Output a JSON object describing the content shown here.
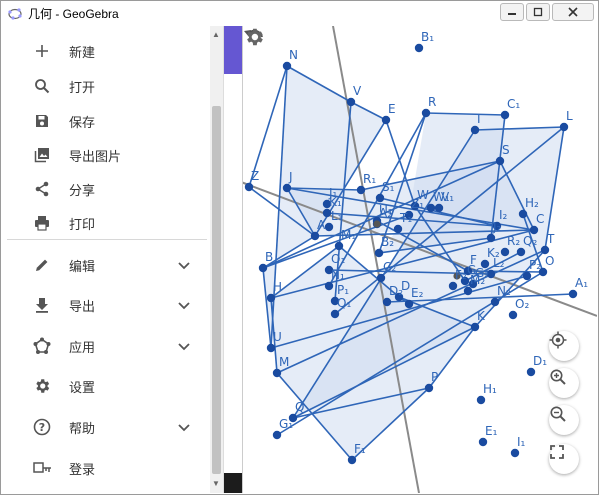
{
  "window": {
    "title": "几何 - GeoGebra"
  },
  "menu": {
    "items": [
      {
        "label": "新建",
        "icon": "plus-icon"
      },
      {
        "label": "打开",
        "icon": "search-icon"
      },
      {
        "label": "保存",
        "icon": "floppy-save-icon"
      },
      {
        "label": "导出图片",
        "icon": "image-export-icon"
      },
      {
        "label": "分享",
        "icon": "share-icon"
      },
      {
        "label": "打印",
        "icon": "printer-icon"
      },
      {
        "label": "编辑",
        "icon": "pencil-icon"
      },
      {
        "label": "导出",
        "icon": "download-icon"
      },
      {
        "label": "应用",
        "icon": "pentagon-apps-icon"
      },
      {
        "label": "设置",
        "icon": "gear-icon"
      },
      {
        "label": "帮助",
        "icon": "help-circle-icon"
      },
      {
        "label": "登录",
        "icon": "sign-in-key-icon"
      }
    ]
  },
  "colors": {
    "accent": "#6557d2",
    "point": "#1a4ba0",
    "segment": "#2f66b8",
    "fill": "#cfdcf1",
    "axis": "#8a8a8a"
  },
  "graphics": {
    "points": [
      {
        "id": "N",
        "label": "N"
      },
      {
        "id": "B1",
        "label": "B₁"
      },
      {
        "id": "V",
        "label": "V"
      },
      {
        "id": "E",
        "label": "E"
      },
      {
        "id": "R",
        "label": "R"
      },
      {
        "id": "C1",
        "label": "C₁"
      },
      {
        "id": "I",
        "label": "I"
      },
      {
        "id": "L",
        "label": "L"
      },
      {
        "id": "S",
        "label": "S"
      },
      {
        "id": "J",
        "label": "J"
      },
      {
        "id": "Z",
        "label": "Z"
      },
      {
        "id": "R1",
        "label": "R₁"
      },
      {
        "id": "S1",
        "label": "S₁"
      },
      {
        "id": "W",
        "label": "W"
      },
      {
        "id": "H2",
        "label": "H₂"
      },
      {
        "id": "C",
        "label": "C"
      },
      {
        "id": "A",
        "label": "A"
      },
      {
        "id": "Q2",
        "label": "Q₂"
      },
      {
        "id": "T",
        "label": "T"
      },
      {
        "id": "B",
        "label": "B"
      },
      {
        "id": "G",
        "label": "G"
      },
      {
        "id": "A1",
        "label": "A₁"
      },
      {
        "id": "H",
        "label": "H"
      },
      {
        "id": "U",
        "label": "U"
      },
      {
        "id": "M",
        "label": "M"
      },
      {
        "id": "Q",
        "label": "Q"
      },
      {
        "id": "G1",
        "label": "G₁"
      },
      {
        "id": "F1",
        "label": "F₁"
      },
      {
        "id": "P",
        "label": "P"
      },
      {
        "id": "H1",
        "label": "H₁"
      },
      {
        "id": "D1",
        "label": "D₁"
      },
      {
        "id": "E1",
        "label": "E₁"
      },
      {
        "id": "I1",
        "label": "I₁"
      },
      {
        "id": "K",
        "label": "K"
      },
      {
        "id": "O2",
        "label": "O₂"
      },
      {
        "id": "N2",
        "label": "N₂"
      },
      {
        "id": "D",
        "label": "D"
      },
      {
        "id": "E2",
        "label": "E₂"
      },
      {
        "id": "P2",
        "label": "P₂"
      },
      {
        "id": "O",
        "label": "O"
      },
      {
        "id": "C2",
        "label": "C₂"
      },
      {
        "id": "B2",
        "label": "B₂"
      },
      {
        "id": "F",
        "label": "F"
      },
      {
        "id": "M2",
        "label": "M₂"
      },
      {
        "id": "K2",
        "label": "K₂"
      },
      {
        "id": "J2",
        "label": "J₂"
      },
      {
        "id": "I2",
        "label": "I₂"
      },
      {
        "id": "R2",
        "label": "R₂"
      },
      {
        "id": "F2",
        "label": "F₂"
      },
      {
        "id": "L2",
        "label": "L₂"
      },
      {
        "id": "G2",
        "label": "G₂"
      },
      {
        "id": "Z1",
        "label": "Z₁"
      },
      {
        "id": "V1",
        "label": "V₁"
      },
      {
        "id": "W1",
        "label": "W₁"
      },
      {
        "id": "U1",
        "label": "U₁"
      },
      {
        "id": "A2",
        "label": "A₂"
      },
      {
        "id": "K1",
        "label": "K₁"
      },
      {
        "id": "J1",
        "label": "J₁"
      },
      {
        "id": "L1",
        "label": "L₁"
      },
      {
        "id": "M1",
        "label": "M₁"
      },
      {
        "id": "O1",
        "label": "O₁"
      },
      {
        "id": "N1",
        "label": "N₁"
      },
      {
        "id": "P1",
        "label": "P₁"
      },
      {
        "id": "Q1",
        "label": "Q₁"
      },
      {
        "id": "D2",
        "label": "D₂"
      },
      {
        "id": "T1",
        "label": "T₁"
      }
    ]
  }
}
